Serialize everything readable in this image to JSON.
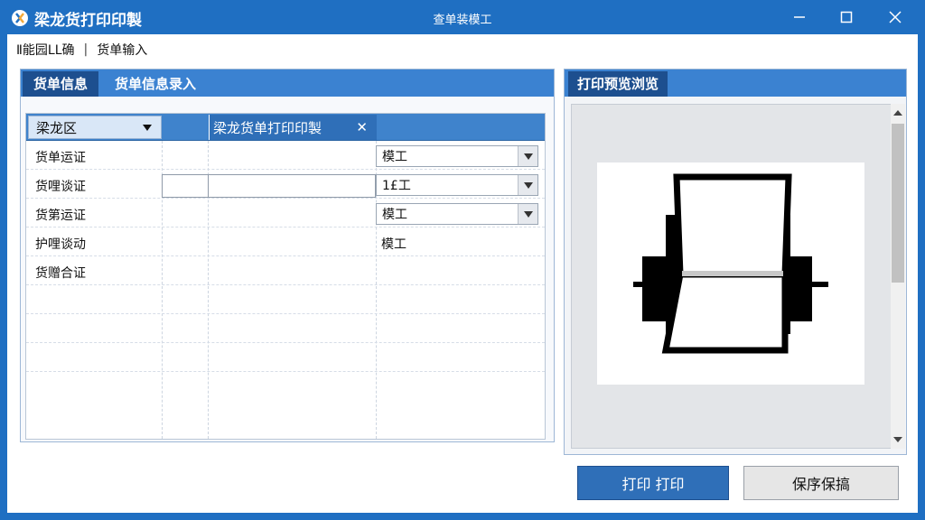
{
  "window": {
    "app_title": "梁龙货打印印製",
    "caption": "查单装模工",
    "title_color": "#1f6fc2"
  },
  "breadcrumb": {
    "item1": "Ⅱ能园LL确",
    "separator": "|",
    "item2": "货单输入"
  },
  "left_tabs": {
    "active": "货单信息",
    "inactive": "货单信息录入"
  },
  "grid": {
    "header_dropdown": "梁龙区",
    "header_tab": "梁龙货单打印印製",
    "rows": [
      {
        "label": "货单运证",
        "value": "模工",
        "has_select": true
      },
      {
        "label": "货哩谈证",
        "value": "1£工",
        "has_select": true
      },
      {
        "label": "货第运证",
        "value": "模工",
        "has_select": true
      },
      {
        "label": "护哩谈动",
        "value": "模工",
        "has_select": false
      },
      {
        "label": "货赠合证",
        "value": "",
        "has_select": false
      }
    ]
  },
  "right_panel": {
    "tab": "打印预览浏览"
  },
  "buttons": {
    "print": "打印 打印",
    "save": "保序保搞"
  },
  "colors": {
    "accent": "#1f6fc2",
    "tab_active": "#1d4f8f",
    "primary_button": "#2f6fb8"
  }
}
